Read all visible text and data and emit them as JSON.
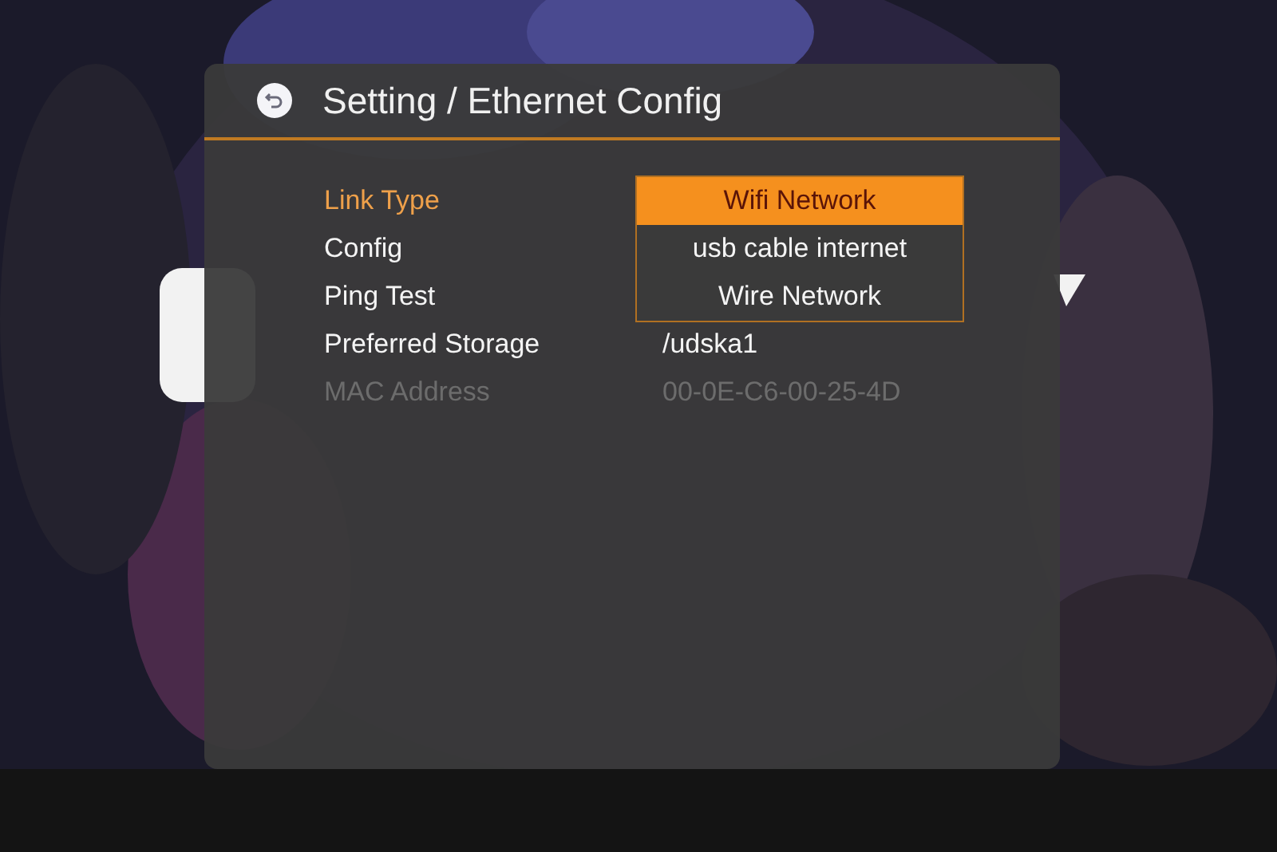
{
  "header": {
    "title": "Setting / Ethernet Config"
  },
  "rows": [
    {
      "label": "Link Type",
      "selected": true,
      "disabled": false,
      "options": [
        {
          "label": "Wifi Network",
          "selected": true
        },
        {
          "label": "usb cable internet",
          "selected": false
        },
        {
          "label": "Wire Network",
          "selected": false
        }
      ]
    },
    {
      "label": "Config",
      "selected": false,
      "disabled": false
    },
    {
      "label": "Ping Test",
      "selected": false,
      "disabled": false
    },
    {
      "label": "Preferred Storage",
      "selected": false,
      "disabled": false,
      "value": "/udska1"
    },
    {
      "label": "MAC Address",
      "selected": false,
      "disabled": true,
      "value": "00-0E-C6-00-25-4D"
    }
  ]
}
